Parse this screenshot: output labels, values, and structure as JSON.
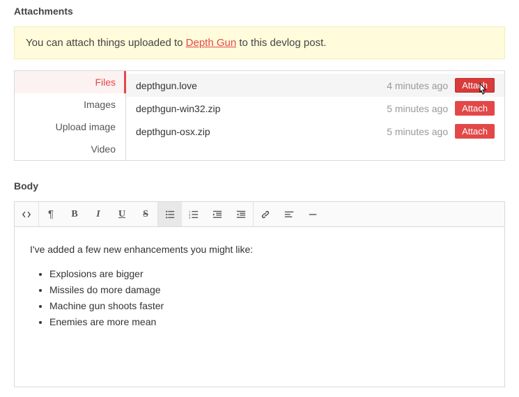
{
  "attachments": {
    "section_label": "Attachments",
    "notice_pre": "You can attach things uploaded to ",
    "notice_link": "Depth Gun",
    "notice_post": " to this devlog post.",
    "tabs": {
      "files": "Files",
      "images": "Images",
      "upload": "Upload image",
      "video": "Video"
    },
    "files": [
      {
        "name": "depthgun.love",
        "time": "4 minutes ago",
        "button": "Attach"
      },
      {
        "name": "depthgun-win32.zip",
        "time": "5 minutes ago",
        "button": "Attach"
      },
      {
        "name": "depthgun-osx.zip",
        "time": "5 minutes ago",
        "button": "Attach"
      }
    ]
  },
  "body": {
    "section_label": "Body",
    "intro": "I've added a few new enhancements you might like:",
    "bullets": [
      "Explosions are bigger",
      "Missiles do more damage",
      "Machine gun shoots faster",
      "Enemies are more mean"
    ]
  }
}
